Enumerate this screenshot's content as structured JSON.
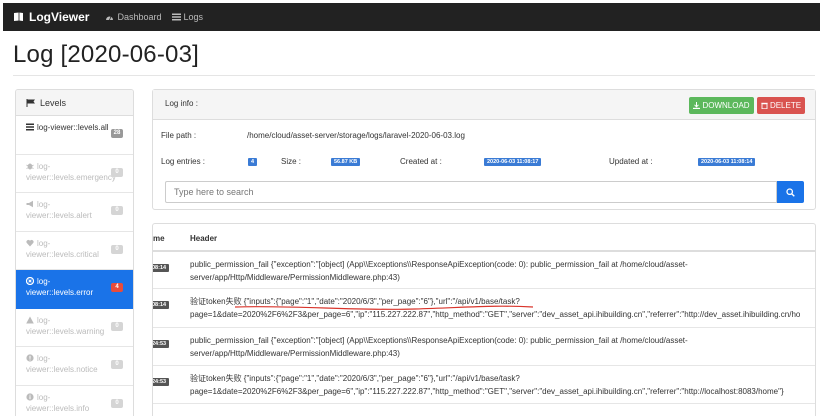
{
  "nav": {
    "brand": "LogViewer",
    "links": [
      "Dashboard",
      "Logs"
    ]
  },
  "page_title": "Log [2020-06-03]",
  "sidebar": {
    "header": "Levels",
    "items": [
      {
        "label": "log-viewer::levels.all",
        "count": "28",
        "state": "normal",
        "icon": "list-icon"
      },
      {
        "label": "log-viewer::levels.emergency",
        "count": "0",
        "state": "dim",
        "icon": "bug-icon"
      },
      {
        "label": "log-viewer::levels.alert",
        "count": "0",
        "state": "dim",
        "icon": "bullhorn-icon"
      },
      {
        "label": "log-viewer::levels.critical",
        "count": "0",
        "state": "dim",
        "icon": "heartbeat-icon"
      },
      {
        "label": "log-viewer::levels.error",
        "count": "4",
        "state": "active",
        "icon": "times-circle-icon"
      },
      {
        "label": "log-viewer::levels.warning",
        "count": "0",
        "state": "dim",
        "icon": "warning-icon"
      },
      {
        "label": "log-viewer::levels.notice",
        "count": "0",
        "state": "dim",
        "icon": "exclamation-circle-icon"
      },
      {
        "label": "log-viewer::levels.info",
        "count": "0",
        "state": "dim",
        "icon": "info-circle-icon"
      }
    ]
  },
  "info": {
    "title": "Log info :",
    "download_label": "DOWNLOAD",
    "delete_label": "DELETE",
    "file_path_label": "File path :",
    "file_path_value": "/home/cloud/asset-server/storage/logs/laravel-2020-06-03.log",
    "entries_label": "Log entries :",
    "entries_value": "4",
    "size_label": "Size :",
    "size_value": "56.87 KB",
    "created_label": "Created at :",
    "created_value": "2020-06-03 11:08:17",
    "updated_label": "Updated at :",
    "updated_value": "2020-06-03 11:08:14",
    "search_placeholder": "Type here to search"
  },
  "table": {
    "col_time": "me",
    "col_header": "Header",
    "rows": [
      {
        "time": "08:14",
        "line1": "public_permission_fail {\"exception\":\"[object] (App\\\\Exceptions\\\\ResponseApiException(code: 0): public_permission_fail at /home/cloud/asset-",
        "line2": "server/app/Http/Middleware/PermissionMiddleware.php:43)"
      },
      {
        "time": "08:14",
        "line1": "验证token失败 {\"inputs\":{\"page\":\"1\",\"date\":\"2020/6/3\",\"per_page\":\"6\"},\"url\":\"/api/v1/base/task?",
        "line2": "page=1&date=2020%2F6%2F3&per_page=6\",\"ip\":\"115.227.222.87\",\"http_method\":\"GET\",\"server\":\"dev_asset_api.ihibuilding.cn\",\"referrer\":\"http://dev_asset.ihibuilding.cn/ho"
      },
      {
        "time": "24:53",
        "line1": "public_permission_fail {\"exception\":\"[object] (App\\\\Exceptions\\\\ResponseApiException(code: 0): public_permission_fail at /home/cloud/asset-",
        "line2": "server/app/Http/Middleware/PermissionMiddleware.php:43)"
      },
      {
        "time": "24:53",
        "line1": "验证token失败 {\"inputs\":{\"page\":\"1\",\"date\":\"2020/6/3\",\"per_page\":\"6\"},\"url\":\"/api/v1/base/task?",
        "line2": "page=1&date=2020%2F6%2F3&per_page=6\",\"ip\":\"115.227.222.87\",\"http_method\":\"GET\",\"server\":\"dev_asset_api.ihibuilding.cn\",\"referrer\":\"http://localhost:8083/home\"}"
      }
    ]
  },
  "colors": {
    "navbar": "#222222",
    "primary": "#1a73e8",
    "success": "#5cb85c",
    "danger": "#d9534f",
    "annotation": "#d9342b"
  }
}
